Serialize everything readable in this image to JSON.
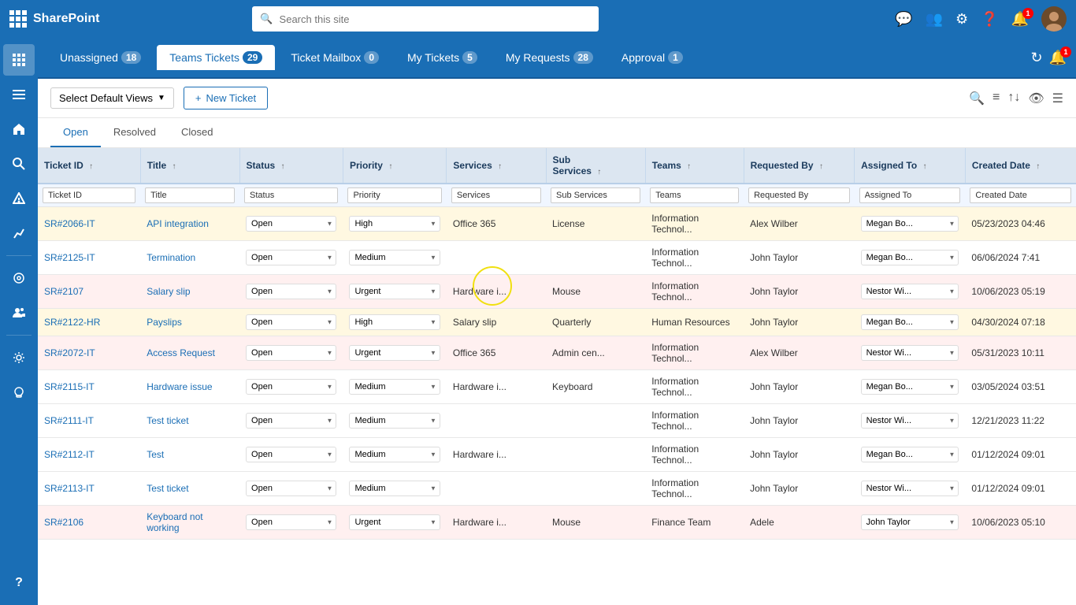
{
  "app": {
    "name": "SharePoint",
    "search_placeholder": "Search this site"
  },
  "tabs": [
    {
      "id": "unassigned",
      "label": "Unassigned",
      "count": "18",
      "active": false
    },
    {
      "id": "teams-tickets",
      "label": "Teams Tickets",
      "count": "29",
      "active": true
    },
    {
      "id": "ticket-mailbox",
      "label": "Ticket Mailbox",
      "count": "0",
      "active": false
    },
    {
      "id": "my-tickets",
      "label": "My Tickets",
      "count": "5",
      "active": false
    },
    {
      "id": "my-requests",
      "label": "My Requests",
      "count": "28",
      "active": false
    },
    {
      "id": "approval",
      "label": "Approval",
      "count": "1",
      "active": false
    }
  ],
  "toolbar": {
    "select_default_views": "Select Default Views",
    "new_ticket": "+ New Ticket"
  },
  "view_tabs": [
    {
      "id": "open",
      "label": "Open",
      "active": true
    },
    {
      "id": "resolved",
      "label": "Resolved",
      "active": false
    },
    {
      "id": "closed",
      "label": "Closed",
      "active": false
    }
  ],
  "table": {
    "columns": [
      {
        "id": "ticket-id",
        "label": "Ticket ID",
        "filter": "Ticket ID"
      },
      {
        "id": "title",
        "label": "Title",
        "filter": "Title"
      },
      {
        "id": "status",
        "label": "Status",
        "filter": "Status"
      },
      {
        "id": "priority",
        "label": "Priority",
        "filter": "Priority"
      },
      {
        "id": "services",
        "label": "Services",
        "filter": "Services"
      },
      {
        "id": "sub-services",
        "label": "Sub Services",
        "filter": "Sub Services"
      },
      {
        "id": "teams",
        "label": "Teams",
        "filter": "Teams"
      },
      {
        "id": "requested-by",
        "label": "Requested By",
        "filter": "Requested By"
      },
      {
        "id": "assigned-to",
        "label": "Assigned To",
        "filter": "Assigned To"
      },
      {
        "id": "created-date",
        "label": "Created Date",
        "filter": "Created Date"
      }
    ],
    "rows": [
      {
        "id": "SR#2066-IT",
        "title": "API integration",
        "status": "Open",
        "priority": "High",
        "services": "Office 365",
        "sub_services": "License",
        "teams": "Information Technol...",
        "requested_by": "Alex Wilber",
        "assigned_to": "Megan Bo...",
        "created_date": "05/23/2023 04:46",
        "row_class": "row-high"
      },
      {
        "id": "SR#2125-IT",
        "title": "Termination",
        "status": "Open",
        "priority": "Medium",
        "services": "",
        "sub_services": "",
        "teams": "Information Technol...",
        "requested_by": "John Taylor",
        "assigned_to": "Megan Bo...",
        "created_date": "06/06/2024 7:41",
        "row_class": "row-medium"
      },
      {
        "id": "SR#2107",
        "title": "Salary slip",
        "status": "Open",
        "priority": "Urgent",
        "services": "Hardware i...",
        "sub_services": "Mouse",
        "teams": "Information Technol...",
        "requested_by": "John Taylor",
        "assigned_to": "Nestor Wi...",
        "created_date": "10/06/2023 05:19",
        "row_class": "row-urgent"
      },
      {
        "id": "SR#2122-HR",
        "title": "Payslips",
        "status": "Open",
        "priority": "High",
        "services": "Salary slip",
        "sub_services": "Quarterly",
        "teams": "Human Resources",
        "requested_by": "John Taylor",
        "assigned_to": "Megan Bo...",
        "created_date": "04/30/2024 07:18",
        "row_class": "row-high"
      },
      {
        "id": "SR#2072-IT",
        "title": "Access Request",
        "status": "Open",
        "priority": "Urgent",
        "services": "Office 365",
        "sub_services": "Admin cen...",
        "teams": "Information Technol...",
        "requested_by": "Alex Wilber",
        "assigned_to": "Nestor Wi...",
        "created_date": "05/31/2023 10:11",
        "row_class": "row-urgent"
      },
      {
        "id": "SR#2115-IT",
        "title": "Hardware issue",
        "status": "Open",
        "priority": "Medium",
        "services": "Hardware i...",
        "sub_services": "Keyboard",
        "teams": "Information Technol...",
        "requested_by": "John Taylor",
        "assigned_to": "Megan Bo...",
        "created_date": "03/05/2024 03:51",
        "row_class": "row-medium"
      },
      {
        "id": "SR#2111-IT",
        "title": "Test ticket",
        "status": "Open",
        "priority": "Medium",
        "services": "",
        "sub_services": "",
        "teams": "Information Technol...",
        "requested_by": "John Taylor",
        "assigned_to": "Nestor Wi...",
        "created_date": "12/21/2023 11:22",
        "row_class": "row-medium"
      },
      {
        "id": "SR#2112-IT",
        "title": "Test",
        "status": "Open",
        "priority": "Medium",
        "services": "Hardware i...",
        "sub_services": "",
        "teams": "Information Technol...",
        "requested_by": "John Taylor",
        "assigned_to": "Megan Bo...",
        "created_date": "01/12/2024 09:01",
        "row_class": "row-medium"
      },
      {
        "id": "SR#2113-IT",
        "title": "Test ticket",
        "status": "Open",
        "priority": "Medium",
        "services": "",
        "sub_services": "",
        "teams": "Information Technol...",
        "requested_by": "John Taylor",
        "assigned_to": "Nestor Wi...",
        "created_date": "01/12/2024 09:01",
        "row_class": "row-medium"
      },
      {
        "id": "SR#2106",
        "title": "Keyboard not working",
        "status": "Open",
        "priority": "Urgent",
        "services": "Hardware i...",
        "sub_services": "Mouse",
        "teams": "Finance Team",
        "requested_by": "Adele",
        "assigned_to": "John Taylor",
        "created_date": "10/06/2023 05:10",
        "row_class": "row-urgent"
      }
    ]
  },
  "sidebar": {
    "items": [
      {
        "id": "waffle",
        "icon": "⊞",
        "label": "Apps"
      },
      {
        "id": "home",
        "icon": "⌂",
        "label": "Home"
      },
      {
        "id": "search",
        "icon": "⊙",
        "label": "Search"
      },
      {
        "id": "alert",
        "icon": "△",
        "label": "Alerts"
      },
      {
        "id": "chart",
        "icon": "↗",
        "label": "Reports"
      },
      {
        "id": "community",
        "icon": "◎",
        "label": "Community"
      },
      {
        "id": "people",
        "icon": "👥",
        "label": "People"
      },
      {
        "id": "settings",
        "icon": "⚙",
        "label": "Settings"
      },
      {
        "id": "lightbulb",
        "icon": "💡",
        "label": "Ideas"
      },
      {
        "id": "help",
        "icon": "?",
        "label": "Help"
      }
    ]
  },
  "notif_count": "1",
  "icons": {
    "search": "🔍",
    "plus": "+",
    "filter": "⊟",
    "sort_asc": "↑",
    "eye": "👁",
    "grid": "⊞",
    "refresh": "↻",
    "bell": "🔔"
  }
}
